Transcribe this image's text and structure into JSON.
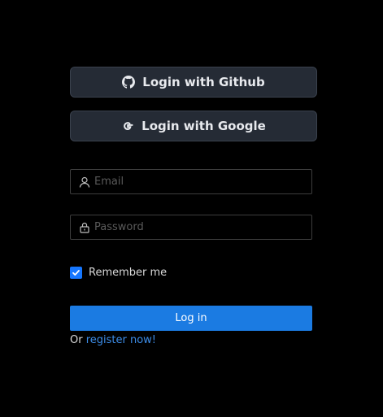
{
  "oauth": {
    "github": {
      "label": "Login with Github",
      "icon": "github-icon"
    },
    "google": {
      "label": "Login with Google",
      "icon": "google-icon"
    }
  },
  "form": {
    "email": {
      "placeholder": "Email",
      "value": "",
      "icon": "user-icon"
    },
    "password": {
      "placeholder": "Password",
      "value": "",
      "icon": "lock-icon"
    },
    "remember": {
      "label": "Remember me",
      "checked": true
    },
    "submit_label": "Log in"
  },
  "register": {
    "prefix": "Or",
    "link_label": "register now!"
  },
  "colors": {
    "background": "#000000",
    "oauth_button_bg": "#252b35",
    "primary": "#1b7be2",
    "link": "#3c8ce7",
    "checkbox": "#1677ff"
  }
}
